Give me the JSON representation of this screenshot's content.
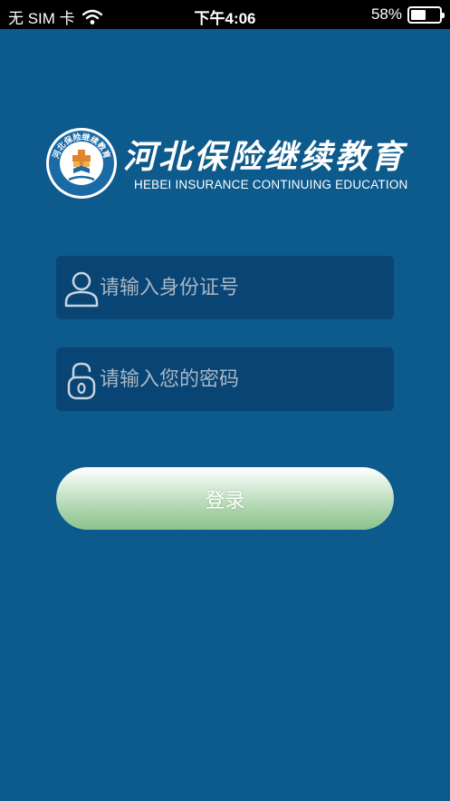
{
  "status_bar": {
    "carrier": "无 SIM 卡",
    "time": "下午4:06",
    "battery_percent": "58%",
    "battery_level": 0.58,
    "wifi_icon": "wifi-icon",
    "battery_icon": "battery-icon"
  },
  "brand": {
    "title": "河北保险继续教育",
    "subtitle": "HEBEI INSURANCE CONTINUING EDUCATION",
    "logo_icon": "hebei-insurance-logo",
    "logo_ring_text": "河北保险继续教育"
  },
  "form": {
    "id_field": {
      "placeholder": "请输入身份证号",
      "value": "",
      "icon": "user-icon"
    },
    "password_field": {
      "placeholder": "请输入您的密码",
      "value": "",
      "icon": "lock-icon"
    },
    "login_label": "登录"
  },
  "colors": {
    "background": "#0d5a8c",
    "field_background": "#084474",
    "button_gradient_top": "#ffffff",
    "button_gradient_bottom": "#8cc28f",
    "text": "#ffffff",
    "placeholder": "#a9b6c4"
  }
}
